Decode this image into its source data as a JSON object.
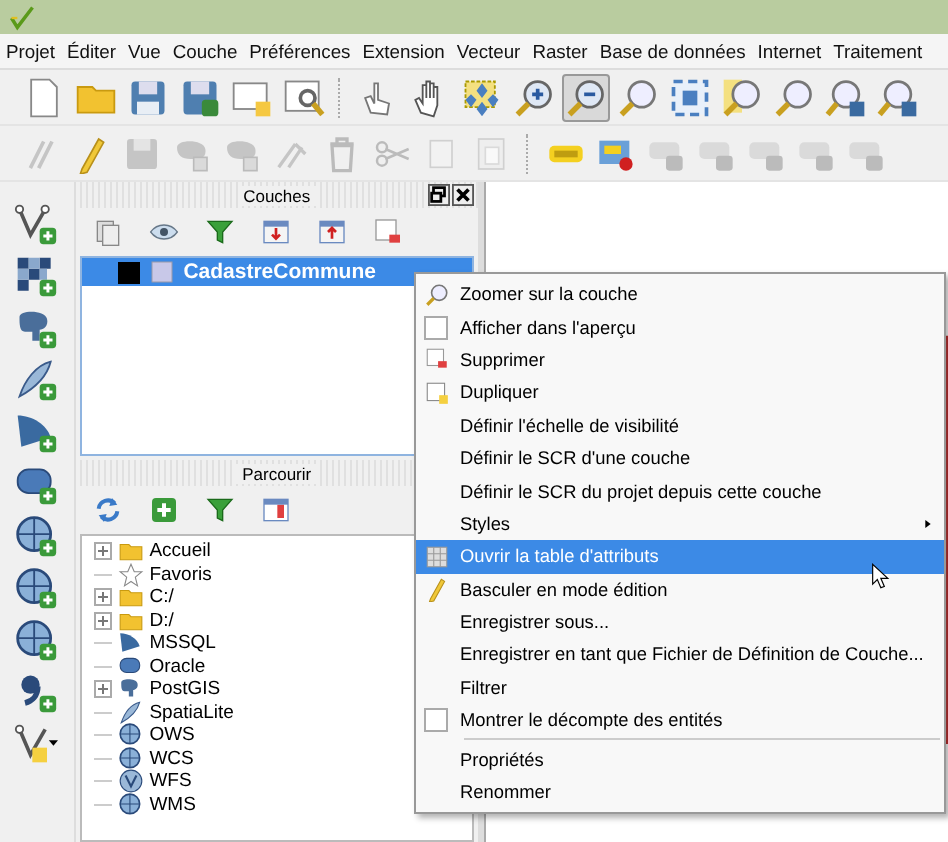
{
  "menu_bar": [
    "Projet",
    "Éditer",
    "Vue",
    "Couche",
    "Préférences",
    "Extension",
    "Vecteur",
    "Raster",
    "Base de données",
    "Internet",
    "Traitement"
  ],
  "toolbar_1": [
    {
      "selected": false
    },
    {
      "selected": false
    },
    {
      "selected": false
    },
    {
      "selected": false
    },
    {
      "selected": false
    },
    {
      "selected": false
    },
    {
      "selected": false
    },
    {
      "selected": false
    },
    {
      "selected": false
    },
    {
      "selected": false
    },
    {
      "selected": true
    },
    {
      "selected": false
    },
    {
      "selected": false
    },
    {
      "selected": false
    },
    {
      "selected": false
    },
    {
      "selected": false
    },
    {
      "selected": false
    }
  ],
  "layers_panel": {
    "title": "Couches",
    "layers": [
      {
        "name": "CadastreCommune",
        "checked": true,
        "selected": true
      }
    ]
  },
  "browser_panel": {
    "title": "Parcourir",
    "items": [
      {
        "label": "Accueil",
        "expandable": true
      },
      {
        "label": "Favoris",
        "expandable": false
      },
      {
        "label": "C:/",
        "expandable": true
      },
      {
        "label": "D:/",
        "expandable": true
      },
      {
        "label": "MSSQL",
        "expandable": false
      },
      {
        "label": "Oracle",
        "expandable": false
      },
      {
        "label": "PostGIS",
        "expandable": true
      },
      {
        "label": "SpatiaLite",
        "expandable": false
      },
      {
        "label": "OWS",
        "expandable": false
      },
      {
        "label": "WCS",
        "expandable": false
      },
      {
        "label": "WFS",
        "expandable": false
      },
      {
        "label": "WMS",
        "expandable": false
      }
    ]
  },
  "context_menu": [
    {
      "kind": "item",
      "label": "Zoomer sur la couche",
      "selected": false
    },
    {
      "kind": "check",
      "label": "Afficher dans l'aperçu",
      "checked": false,
      "selected": false
    },
    {
      "kind": "item",
      "label": "Supprimer",
      "selected": false
    },
    {
      "kind": "item",
      "label": "Dupliquer",
      "selected": false
    },
    {
      "kind": "item",
      "label": "Définir l'échelle de visibilité",
      "selected": false
    },
    {
      "kind": "item",
      "label": "Définir le SCR d'une couche",
      "selected": false
    },
    {
      "kind": "item",
      "label": "Définir le SCR du projet depuis cette couche",
      "selected": false
    },
    {
      "kind": "submenu",
      "label": "Styles",
      "selected": false
    },
    {
      "kind": "item",
      "label": "Ouvrir la table d'attributs",
      "selected": true
    },
    {
      "kind": "item",
      "label": "Basculer en mode édition",
      "selected": false
    },
    {
      "kind": "item",
      "label": "Enregistrer sous...",
      "selected": false
    },
    {
      "kind": "item",
      "label": "Enregistrer en tant que Fichier de Définition de Couche...",
      "selected": false
    },
    {
      "kind": "item",
      "label": "Filtrer",
      "selected": false
    },
    {
      "kind": "check",
      "label": "Montrer le décompte des entités",
      "checked": false,
      "selected": false
    },
    {
      "kind": "separator"
    },
    {
      "kind": "item",
      "label": "Propriétés",
      "selected": false
    },
    {
      "kind": "item",
      "label": "Renommer",
      "selected": false
    }
  ]
}
